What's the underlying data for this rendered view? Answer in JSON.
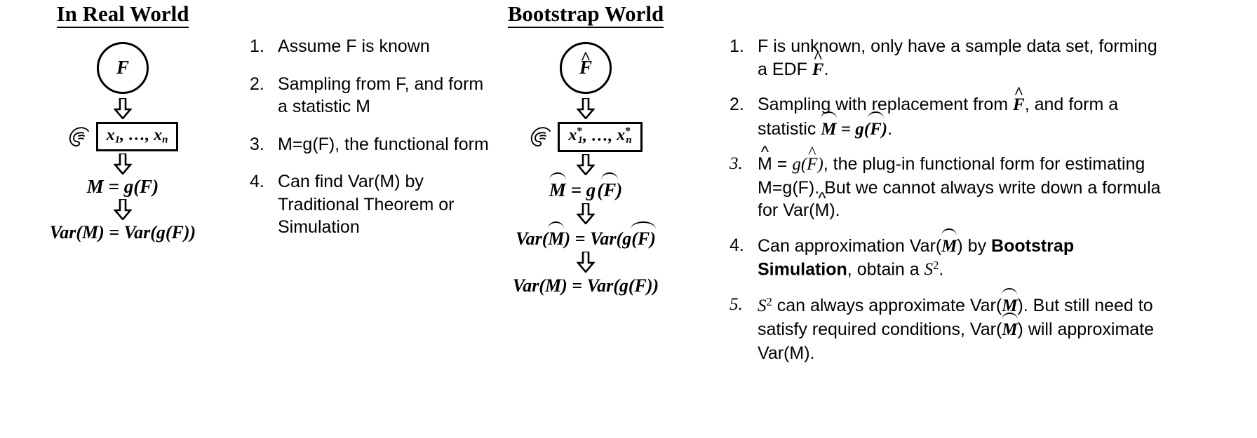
{
  "left_column": {
    "title": "In Real World",
    "flow": {
      "circle_label": "F",
      "sample_box": "x₁, …, xₙ",
      "statistic": "M = g(F)",
      "variance": "Var(M) = Var(g(F))",
      "arrow_icon": "down-block-arrow-icon",
      "hand_icon": "hand-grab-icon"
    },
    "steps": [
      {
        "num": "1.",
        "text": "Assume F is known"
      },
      {
        "num": "2.",
        "text": "Sampling from F, and form a statistic M"
      },
      {
        "num": "3.",
        "text": "M=g(F), the functional form"
      },
      {
        "num": "4.",
        "text": "Can find Var(M) by Traditional Theorem or Simulation"
      }
    ]
  },
  "right_column": {
    "title": "Bootstrap World",
    "flow": {
      "circle_label": "F̂",
      "sample_box": "x*₁, …, x*ₙ",
      "statistic": "M̂ = g(F̂)",
      "variance_hat": "Var(M̂) = Var(g(F̂))",
      "variance_true": "Var(M) = Var(g(F))",
      "arrow_icon": "down-block-arrow-icon",
      "hand_icon": "hand-grab-icon"
    },
    "steps": [
      {
        "num": "1.",
        "text": "F is unknown, only have a sample data set, forming a EDF F̂."
      },
      {
        "num": "2.",
        "text": "Sampling with replacement from F̂, and form a statistic M̂ = g(F̂)."
      },
      {
        "num": "3.",
        "text": "M̂ = g(F̂), the plug-in functional form for estimating M=g(F). But we cannot always write down a formula for Var(M̂)."
      },
      {
        "num": "4.",
        "text": "Can approximation Var(M̂) by Bootstrap Simulation, obtain a S²."
      },
      {
        "num": "5.",
        "text": "S² can always approximate Var(M̂). But still need to satisfy required conditions, Var(M̂) will approximate Var(M)."
      }
    ],
    "emphasis": "Bootstrap Simulation"
  },
  "colors": {
    "ink": "#000000",
    "background": "#ffffff",
    "subscript_accent": "#1f3864"
  }
}
